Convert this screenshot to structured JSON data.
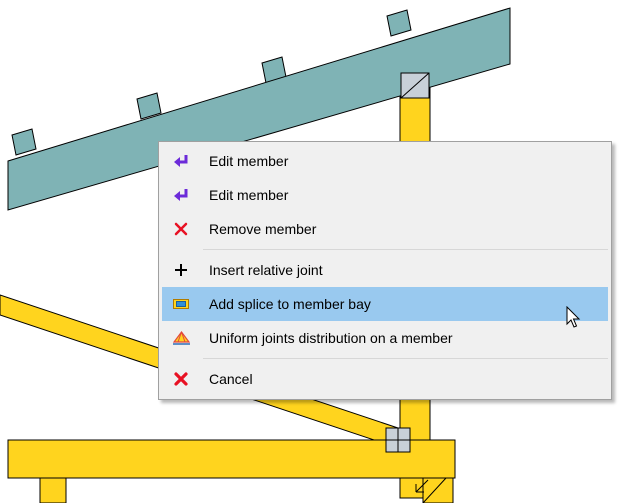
{
  "context_menu": {
    "group_1": [
      {
        "label": "Edit member",
        "icon": "edit-member-icon"
      },
      {
        "label": "Edit member",
        "icon": "edit-member-icon"
      },
      {
        "label": "Remove member",
        "icon": "remove-icon"
      }
    ],
    "group_2": [
      {
        "label": "Insert relative joint",
        "icon": "plus-icon"
      },
      {
        "label": "Add splice to member bay",
        "icon": "splice-icon",
        "highlighted": true
      },
      {
        "label": "Uniform joints distribution on a member",
        "icon": "uniform-joints-icon"
      }
    ],
    "group_3": [
      {
        "label": "Cancel",
        "icon": "cancel-icon"
      }
    ]
  },
  "colors": {
    "rafter": "#7fb3b5",
    "member": "#ffd41e",
    "outline": "#000000",
    "joint_plate": "#c8d0d8",
    "menu_background": "#f0f0f0",
    "menu_highlight": "#99c9ef",
    "edit_icon": "#6c2bd9",
    "remove_icon": "#e81123"
  }
}
